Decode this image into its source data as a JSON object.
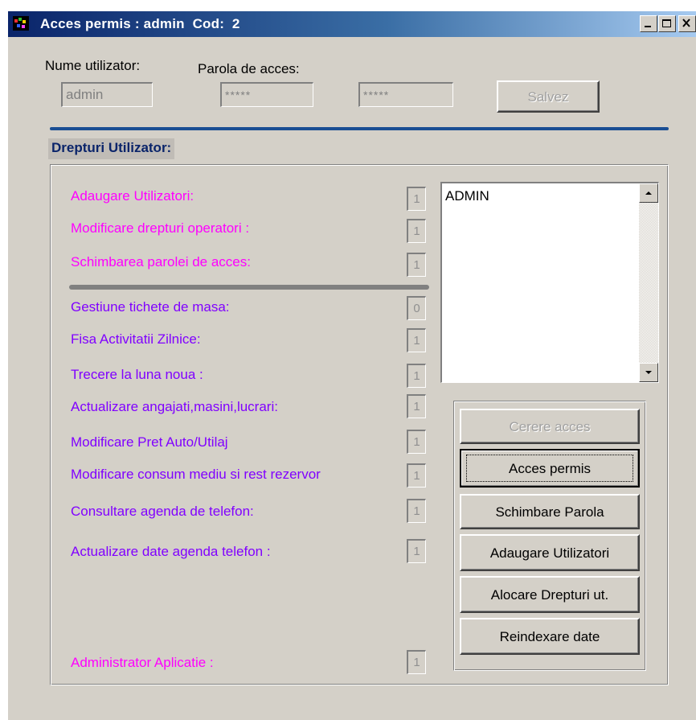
{
  "window": {
    "title": "Acces permis : admin  Cod:  2",
    "controls": {
      "minimize": "minimize-icon",
      "maximize": "maximize-icon",
      "close": "close-icon"
    }
  },
  "user_form": {
    "username_label": "Nume utilizator:",
    "password_label": "Parola de acces:",
    "username_value": "admin",
    "password_value": "*****",
    "password_confirm_value": "*****",
    "save_button": "Salvez"
  },
  "rights": {
    "section_title": "Drepturi Utilizator:",
    "items": [
      {
        "label": "Adaugare Utilizatori:",
        "value": "1",
        "color": "#ff00ff"
      },
      {
        "label": "Modificare drepturi operatori :",
        "value": "1",
        "color": "#ff00ff"
      },
      {
        "label": "Schimbarea parolei de acces:",
        "value": "1",
        "color": "#ff00ff"
      },
      {
        "label": "Gestiune tichete de masa:",
        "value": "0",
        "color": "#8000ff"
      },
      {
        "label": "Fisa Activitatii Zilnice:",
        "value": "1",
        "color": "#8000ff"
      },
      {
        "label": "Trecere la luna noua :",
        "value": "1",
        "color": "#8000ff"
      },
      {
        "label": "Actualizare angajati,masini,lucrari:",
        "value": "1",
        "color": "#8000ff"
      },
      {
        "label": "Modificare Pret Auto/Utilaj",
        "value": "1",
        "color": "#8000ff"
      },
      {
        "label": "Modificare consum mediu si rest rezervor",
        "value": "1",
        "color": "#8000ff"
      },
      {
        "label": "Consultare agenda de telefon:",
        "value": "1",
        "color": "#8000ff"
      },
      {
        "label": "Actualizare date agenda telefon :",
        "value": "1",
        "color": "#8000ff"
      },
      {
        "label": "Administrator  Aplicatie :",
        "value": "1",
        "color": "#ff00ff"
      }
    ]
  },
  "users_list": {
    "items": [
      "ADMIN"
    ]
  },
  "actions": {
    "request_access": "Cerere acces",
    "access_granted": "Acces permis",
    "change_password": "Schimbare Parola",
    "add_users": "Adaugare Utilizatori",
    "allocate_rights": "Alocare Drepturi ut.",
    "reindex_data": "Reindexare date"
  }
}
